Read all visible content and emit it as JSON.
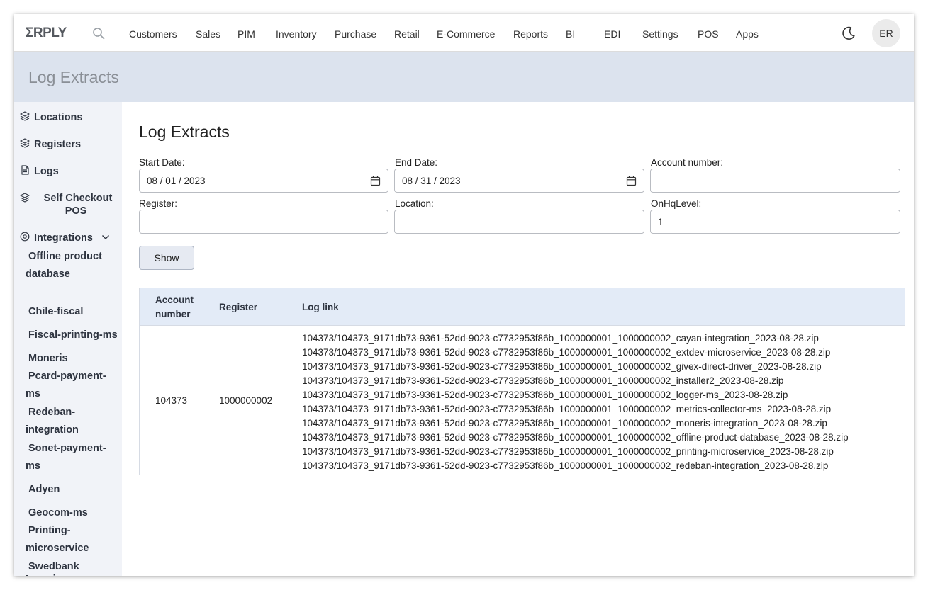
{
  "app": {
    "logo": "ΣRPLY",
    "avatar": "ER"
  },
  "nav": [
    "Customers",
    "Sales",
    "PIM",
    "Inventory",
    "Purchase",
    "Retail",
    "E-Commerce",
    "Reports",
    "BI",
    "EDI",
    "Settings",
    "POS",
    "Apps"
  ],
  "header": {
    "title": "Log Extracts"
  },
  "sidebar": {
    "locations": "Locations",
    "registers": "Registers",
    "logs": "Logs",
    "self_checkout": "Self Checkout POS",
    "integrations": "Integrations",
    "sub_items": [
      "Offline product database",
      "Chile-fiscal",
      "Fiscal-printing-ms",
      "Moneris",
      "Pcard-payment-ms",
      "Redeban-integration",
      "Sonet-payment-ms",
      "Adyen",
      "Geocom-ms",
      "Printing-microservice",
      "Swedbank Ingenico"
    ]
  },
  "main": {
    "title": "Log Extracts"
  },
  "form": {
    "start_date_label": "Start Date:",
    "start_date_value": "08 / 01 / 2023",
    "end_date_label": "End Date:",
    "end_date_value": "08 / 31 / 2023",
    "account_label": "Account number:",
    "account_value": "",
    "register_label": "Register:",
    "register_value": "",
    "location_label": "Location:",
    "location_value": "",
    "onhq_label": "OnHqLevel:",
    "onhq_value": "1",
    "show_button": "Show"
  },
  "table": {
    "headers": {
      "account_line1": "Account",
      "account_line2": "number",
      "register": "Register",
      "log_link": "Log link"
    },
    "row": {
      "account": "104373",
      "register": "1000000002",
      "links": [
        "104373/104373_9171db73-9361-52dd-9023-c7732953f86b_1000000001_1000000002_cayan-integration_2023-08-28.zip",
        "104373/104373_9171db73-9361-52dd-9023-c7732953f86b_1000000001_1000000002_extdev-microservice_2023-08-28.zip",
        "104373/104373_9171db73-9361-52dd-9023-c7732953f86b_1000000001_1000000002_givex-direct-driver_2023-08-28.zip",
        "104373/104373_9171db73-9361-52dd-9023-c7732953f86b_1000000001_1000000002_installer2_2023-08-28.zip",
        "104373/104373_9171db73-9361-52dd-9023-c7732953f86b_1000000001_1000000002_logger-ms_2023-08-28.zip",
        "104373/104373_9171db73-9361-52dd-9023-c7732953f86b_1000000001_1000000002_metrics-collector-ms_2023-08-28.zip",
        "104373/104373_9171db73-9361-52dd-9023-c7732953f86b_1000000001_1000000002_moneris-integration_2023-08-28.zip",
        "104373/104373_9171db73-9361-52dd-9023-c7732953f86b_1000000001_1000000002_offline-product-database_2023-08-28.zip",
        "104373/104373_9171db73-9361-52dd-9023-c7732953f86b_1000000001_1000000002_printing-microservice_2023-08-28.zip",
        "104373/104373_9171db73-9361-52dd-9023-c7732953f86b_1000000001_1000000002_redeban-integration_2023-08-28.zip"
      ]
    }
  }
}
